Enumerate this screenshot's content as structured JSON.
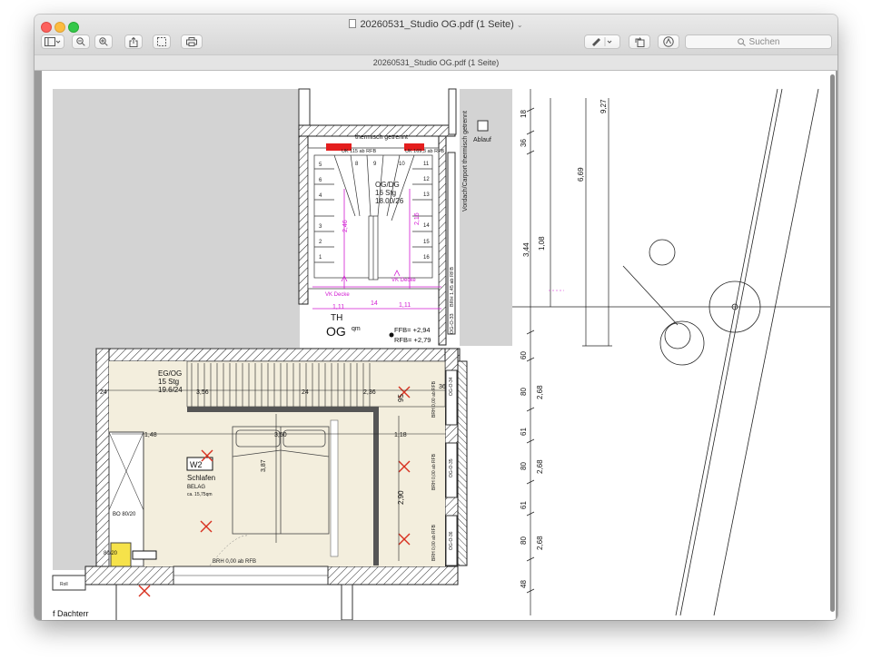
{
  "window": {
    "title": "20260531_Studio OG.pdf (1 Seite)",
    "subtitle": "20260531_Studio OG.pdf (1 Seite)"
  },
  "toolbar": {
    "sidebar_icon": "sidebar-icon",
    "zoom_out_icon": "zoom-out-icon",
    "zoom_in_icon": "zoom-in-icon",
    "share_icon": "share-icon",
    "select_icon": "selection-icon",
    "print_icon": "print-icon",
    "markup_icon": "markup-pen-icon",
    "rotate_icon": "rotate-icon",
    "annotate_icon": "annotate-icon",
    "search_placeholder": "Suchen"
  },
  "plan": {
    "stair_og_dg": "OG/DG",
    "stair_og_dg_steps": "16 Stg",
    "stair_og_dg_dim": "18.00/26",
    "stair_eg_og": "EG/OG",
    "stair_eg_og_steps": "15 Stg",
    "stair_eg_og_dim": "19.6/24",
    "room_th": "TH",
    "room_og": "OG",
    "room_og_sup": "qm",
    "ffb": "FFB= +2,94",
    "rfb": "RFB= +2,79",
    "ablauf": "Ablauf",
    "vordach": "Vordach/Carport thermisch getrennt",
    "thermisch": "thermisch getrennt",
    "uk1": "UK 115 ab RFB",
    "uk2": "UK 169,3 ab RFB",
    "w_label": "W2",
    "room_name": "Schlafen",
    "room_floor": "BELAG",
    "room_area": "ca. 15,75qm",
    "brh_bottom": "BRH 0,00 ab RFB",
    "brh_side1": "BRH 0,00 ab RFB",
    "brh_side2": "BRH 0,00 ab RFB",
    "brh_side3": "BRH 0,00 ab RFB",
    "brh_top": "BRH 1,45 ab RFB",
    "og_w33": "OG-O-33",
    "og_w34": "OG-O-34",
    "og_w35": "OG-O-35",
    "og_w36": "OG-O-36",
    "roll": "Roll",
    "dachterr": "f Dachterr",
    "vk_decke1": "VK Decke",
    "vk_decke2": "VK Decke",
    "bo": "BO 80/20",
    "bo2": "80/20",
    "dim_356": "3,56",
    "dim_236": "2,36",
    "dim_24a": "24",
    "dim_24b": "24",
    "dim_24c": "24",
    "dim_36": "36",
    "dim_350": "3,50",
    "dim_387": "3,87",
    "dim_148": "1,48",
    "dim_118": "1,18",
    "dim_290": "2,90",
    "dim_111a": "1,11",
    "dim_111b": "1,11",
    "dim_14": "14",
    "dim_246": "2,46",
    "dim_216": "2,16",
    "dim_927": "9,27",
    "dim_669": "6,69",
    "dim_344": "3,44",
    "dim_108": "1,08",
    "dim_18": "18",
    "dim_36b": "36",
    "dim_60": "60",
    "dim_80a": "80",
    "dim_268a": "2,68",
    "dim_61a": "61",
    "dim_80b": "80",
    "dim_268b": "2,68",
    "dim_61b": "61",
    "dim_80c": "80",
    "dim_268c": "2,68",
    "dim_48": "48",
    "dim_955": "95"
  }
}
